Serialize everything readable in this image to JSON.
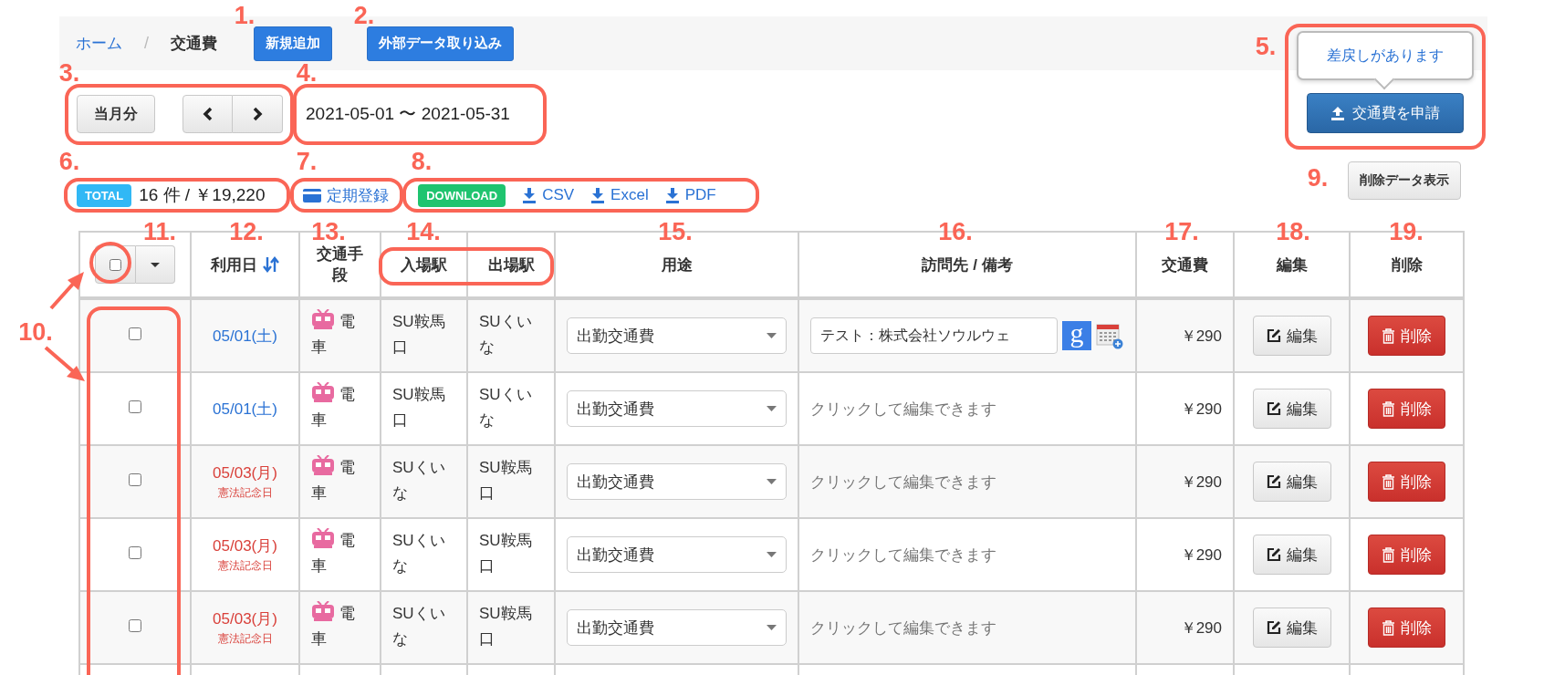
{
  "breadcrumb": {
    "items": [
      {
        "label": "ホーム",
        "kind": "link"
      },
      {
        "label": "交通費",
        "kind": "current"
      }
    ],
    "separator": "/"
  },
  "header_buttons": [
    "新規追加",
    "外部データ取り込み"
  ],
  "period": {
    "current_button": "当月分",
    "date_range": "2021-05-01 〜 2021-05-31"
  },
  "apply": {
    "notice": "差戻しがあります",
    "button": "交通費を申請"
  },
  "total": {
    "badge": "TOTAL",
    "summary": "16 件 / ￥19,220"
  },
  "commuter_link": "定期登録",
  "download": {
    "badge": "DOWNLOAD",
    "links": [
      "CSV",
      "Excel",
      "PDF"
    ]
  },
  "show_deleted_button": "削除データ表示",
  "table": {
    "columns": [
      {
        "kind": "select",
        "checked": false
      },
      {
        "kind": "sortable",
        "label": "利用日"
      },
      {
        "kind": "text",
        "label": "交通手段"
      },
      {
        "kind": "text",
        "label": "入場駅"
      },
      {
        "kind": "text",
        "label": "出場駅"
      },
      {
        "kind": "text",
        "label": "用途"
      },
      {
        "kind": "text",
        "label": "訪問先 / 備考"
      },
      {
        "kind": "text",
        "label": "交通費"
      },
      {
        "kind": "text",
        "label": "編集"
      },
      {
        "kind": "text",
        "label": "削除"
      }
    ],
    "rows": [
      {
        "selected": false,
        "date": "05/01(土)",
        "holiday": false,
        "transport": "電車",
        "entry": "SU鞍馬口",
        "exit": "SUくいな",
        "purpose": "出勤交通費",
        "note": {
          "kind": "value",
          "text": "テスト：株式会社ソウルウェ",
          "badge": "g"
        },
        "amount": "￥290",
        "edit": "編集",
        "delete": "削除"
      },
      {
        "selected": false,
        "date": "05/01(土)",
        "holiday": false,
        "transport": "電車",
        "entry": "SU鞍馬口",
        "exit": "SUくいな",
        "purpose": "出勤交通費",
        "note": {
          "kind": "placeholder",
          "text": "クリックして編集できます"
        },
        "amount": "￥290",
        "edit": "編集",
        "delete": "削除"
      },
      {
        "selected": false,
        "date": "05/03(月)",
        "holiday": true,
        "holiday_name": "憲法記念日",
        "transport": "電車",
        "entry": "SUくいな",
        "exit": "SU鞍馬口",
        "purpose": "出勤交通費",
        "note": {
          "kind": "placeholder",
          "text": "クリックして編集できます"
        },
        "amount": "￥290",
        "edit": "編集",
        "delete": "削除"
      },
      {
        "selected": false,
        "date": "05/03(月)",
        "holiday": true,
        "holiday_name": "憲法記念日",
        "transport": "電車",
        "entry": "SUくいな",
        "exit": "SU鞍馬口",
        "purpose": "出勤交通費",
        "note": {
          "kind": "placeholder",
          "text": "クリックして編集できます"
        },
        "amount": "￥290",
        "edit": "編集",
        "delete": "削除"
      },
      {
        "selected": false,
        "date": "05/03(月)",
        "holiday": true,
        "holiday_name": "憲法記念日",
        "transport": "電車",
        "entry": "SUくいな",
        "exit": "SU鞍馬口",
        "purpose": "出勤交通費",
        "note": {
          "kind": "placeholder",
          "text": "クリックして編集できます"
        },
        "amount": "￥290",
        "edit": "編集",
        "delete": "削除"
      }
    ]
  },
  "annotations": [
    {
      "label": "1."
    },
    {
      "label": "2."
    },
    {
      "label": "3."
    },
    {
      "label": "4."
    },
    {
      "label": "5."
    },
    {
      "label": "6."
    },
    {
      "label": "7."
    },
    {
      "label": "8."
    },
    {
      "label": "9."
    },
    {
      "label": "10."
    },
    {
      "label": "11."
    },
    {
      "label": "12."
    },
    {
      "label": "13."
    },
    {
      "label": "14."
    },
    {
      "label": "15."
    },
    {
      "label": "16."
    },
    {
      "label": "17."
    },
    {
      "label": "18."
    },
    {
      "label": "19."
    }
  ]
}
